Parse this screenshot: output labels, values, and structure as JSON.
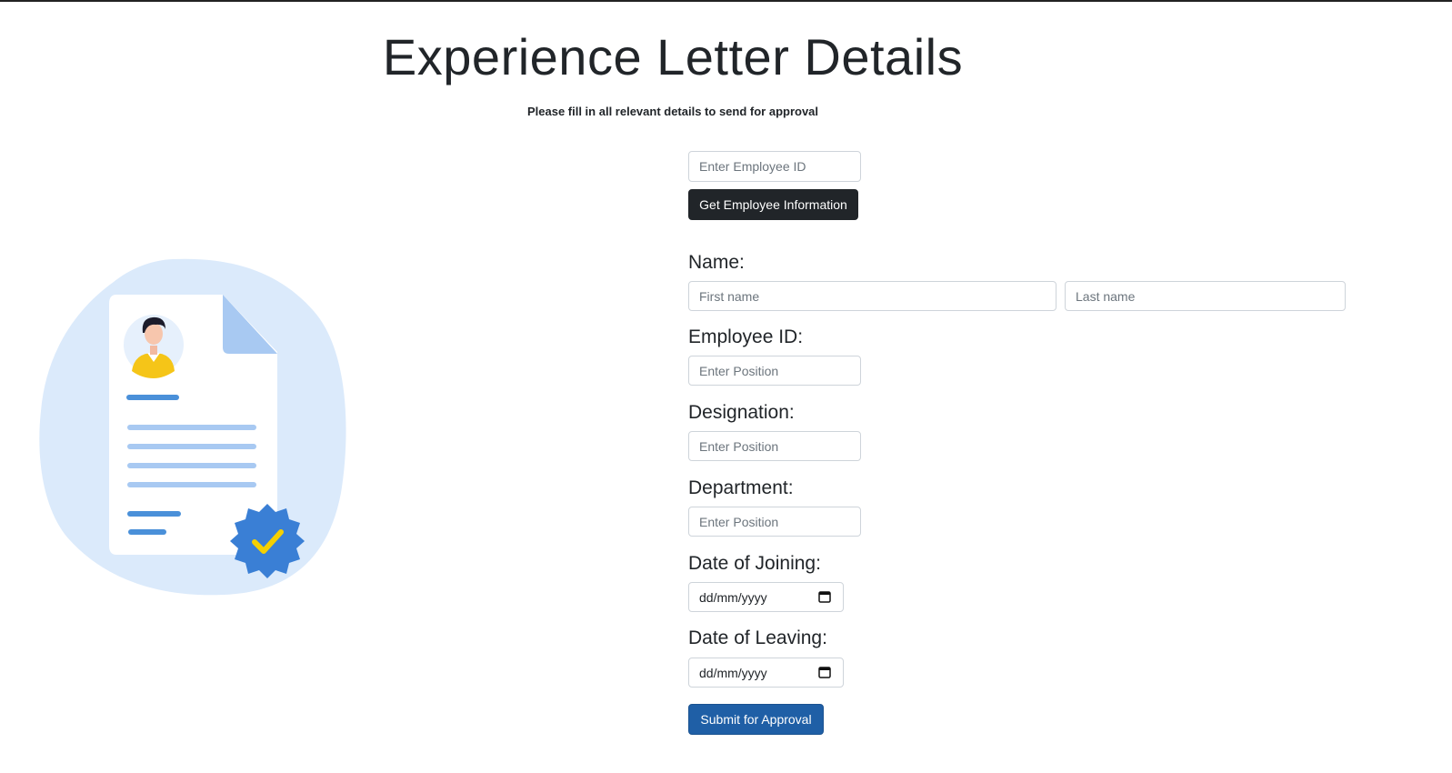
{
  "header": {
    "title": "Experience Letter Details",
    "subtitle": "Please fill in all relevant details to send for approval"
  },
  "lookup": {
    "employee_id_placeholder": "Enter Employee ID",
    "get_info_label": "Get Employee Information"
  },
  "form": {
    "name_label": "Name:",
    "first_name_placeholder": "First name",
    "last_name_placeholder": "Last name",
    "employee_id_label": "Employee ID:",
    "employee_id_placeholder": "Enter Position",
    "designation_label": "Designation:",
    "designation_placeholder": "Enter Position",
    "department_label": "Department:",
    "department_placeholder": "Enter Position",
    "joining_label": "Date of Joining:",
    "joining_value": "dd/mm/yyyy",
    "leaving_label": "Date of Leaving:",
    "leaving_value": "dd/mm/yyyy",
    "submit_label": "Submit for Approval"
  },
  "icons": {
    "calendar": "calendar-icon",
    "illustration": "document-certificate-illustration"
  },
  "colors": {
    "primary_button": "#1f5fa6",
    "dark_button": "#212529",
    "illustration_bg": "#dbeafb",
    "illustration_accent": "#4a90d9",
    "avatar_shirt": "#f5c518"
  }
}
